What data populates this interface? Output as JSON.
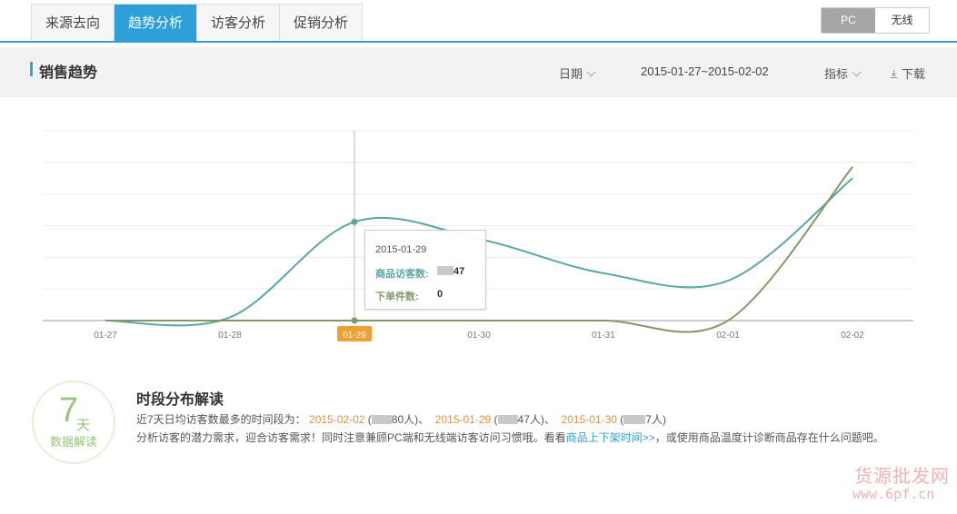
{
  "tabs": [
    {
      "label": "来源去向",
      "active": false
    },
    {
      "label": "趋势分析",
      "active": true
    },
    {
      "label": "访客分析",
      "active": false
    },
    {
      "label": "促销分析",
      "active": false
    }
  ],
  "device_toggle": {
    "pc": "PC",
    "mobile": "无线",
    "selected": "PC"
  },
  "section": {
    "title": "销售趋势",
    "date_label": "日期",
    "date_range": "2015-01-27~2015-02-02",
    "indicator_label": "指标",
    "download_label": "下载"
  },
  "chart_data": {
    "type": "line",
    "categories": [
      "01-27",
      "01-28",
      "01-29",
      "01-30",
      "01-31",
      "02-01",
      "02-02"
    ],
    "series": [
      {
        "name": "商品访客数",
        "color": "#5aa7a6",
        "values": [
          0,
          0.017,
          0.52,
          0.43,
          0.25,
          0.21,
          0.75
        ]
      },
      {
        "name": "下单件数",
        "color": "#829867",
        "values": [
          0,
          0,
          0,
          0,
          0,
          0,
          0.81
        ]
      }
    ],
    "highlight_category": "01-29",
    "grid": true,
    "ylim": [
      0,
      1
    ]
  },
  "tooltip": {
    "date": "2015-01-29",
    "row1_label": "商品访客数:",
    "row1_value": "47",
    "row2_label": "下单件数:",
    "row2_value": "0"
  },
  "interpretation": {
    "badge_num": "7",
    "badge_unit": "天",
    "badge_label": "数据解读",
    "title": "时段分布解读",
    "line1_prefix": "近7天日均访客数最多的时间段为：",
    "items": [
      {
        "date": "2015-02-02",
        "suffix": "80人)、"
      },
      {
        "date": "2015-01-29",
        "suffix": "47人)、"
      },
      {
        "date": "2015-01-30",
        "suffix": "7人)"
      }
    ],
    "line2_text": "分析访客的潜力需求，迎合访客需求！同时注意兼顾PC端和无线端访客访问习惯哦。看看",
    "line2_link": "商品上下架时间>>",
    "line2_suffix": "，或使用商品温度计诊断商品存在什么问题吧。"
  },
  "watermark": {
    "line1": "货源批发网",
    "line2": "www.6pf.cn"
  }
}
